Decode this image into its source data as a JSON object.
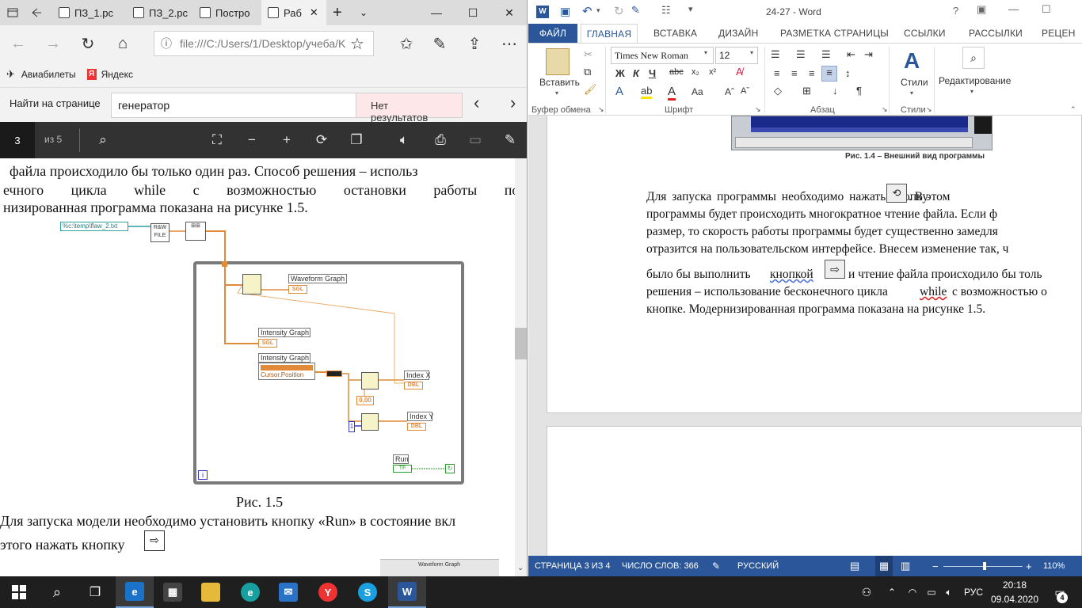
{
  "edge": {
    "tabs": [
      {
        "label": "ПЗ_1.рс"
      },
      {
        "label": "ПЗ_2.рс"
      },
      {
        "label": "Постро"
      },
      {
        "label": "Раб"
      }
    ],
    "address": "file:///C:/Users/1/Desktop/учеба/K",
    "favorites": [
      {
        "label": "Авиабилеты"
      },
      {
        "label": "Яндекс"
      }
    ],
    "find": {
      "label": "Найти на странице",
      "value": "генератор",
      "result": "Нет результатов"
    },
    "pdf": {
      "page": "3",
      "of": "из 5"
    },
    "doc": {
      "lines": [
        "файла происходило бы только один раз. Способ решения – использ",
        "ечного цикла while с возможностью остановки работы по к",
        "низированная программа показана на рисунке 1.5."
      ],
      "caption": "Рис. 1.5",
      "bottom_lines": [
        "Для запуска модели необходимо установить кнопку «Run» в состояние вкл",
        "этого нажать кнопку"
      ],
      "diagram": {
        "path": "%c:\\temp\\flaw_2.txt",
        "waveform": "Waveform Graph",
        "intensity1": "Intensity Graph",
        "intensity2": "Intensity Graph",
        "cursor": "Cursor.Position",
        "index_x": "Index X",
        "index_y": "Index Y",
        "zero": "0,00",
        "run": "Run",
        "dbl": "DBL",
        "tf": "TF",
        "sgl": "SGL",
        "i32": "I32",
        "loop_i": "i",
        "one": "1",
        "bottom_label": "Waveform Graph"
      }
    }
  },
  "word": {
    "title": "24-27 - Word",
    "tabs": [
      "ФАЙЛ",
      "ГЛАВНАЯ",
      "ВСТАВКА",
      "ДИЗАЙН",
      "РАЗМЕТКА СТРАНИЦЫ",
      "ССЫЛКИ",
      "РАССЫЛКИ",
      "РЕЦЕН"
    ],
    "ribbon": {
      "paste": "Вставить",
      "font": "Times New Roman",
      "size": "12",
      "styles": "Стили",
      "editing": "Редактирование",
      "groups": [
        "Буфер обмена",
        "Шрифт",
        "Абзац",
        "Стили"
      ]
    },
    "doc": {
      "fig_caption": "Рис. 1.4 – Внешний вид программы",
      "lines": [
        "Для запуска программы необходимо нажать кнопку",
        ". В этом",
        "программы будет происходить многократное чтение файла. Если ф",
        "размер, то скорость работы программы будет существенно замедля",
        "отразится на пользовательском интерфейсе.  Внесем изменение так, ч",
        "было бы выполнить",
        "кнопкой",
        "и чтение файла происходило бы толь",
        "решения – использование бесконечного цикла",
        "while",
        "с возможностью о",
        "кнопке. Модернизированная программа показана на рисунке 1.5."
      ]
    },
    "status": {
      "page": "СТРАНИЦА 3 ИЗ 4",
      "words": "ЧИСЛО СЛОВ: 366",
      "lang": "РУССКИЙ",
      "zoom": "110%"
    }
  },
  "taskbar": {
    "lang": "РУС",
    "time": "20:18",
    "date": "09.04.2020",
    "notifications": "4"
  },
  "colors": {
    "word_blue": "#2b579a",
    "taskbar": "#1f1f1f",
    "pdf_toolbar": "#323232",
    "wire_orange": "#e08a3a"
  }
}
